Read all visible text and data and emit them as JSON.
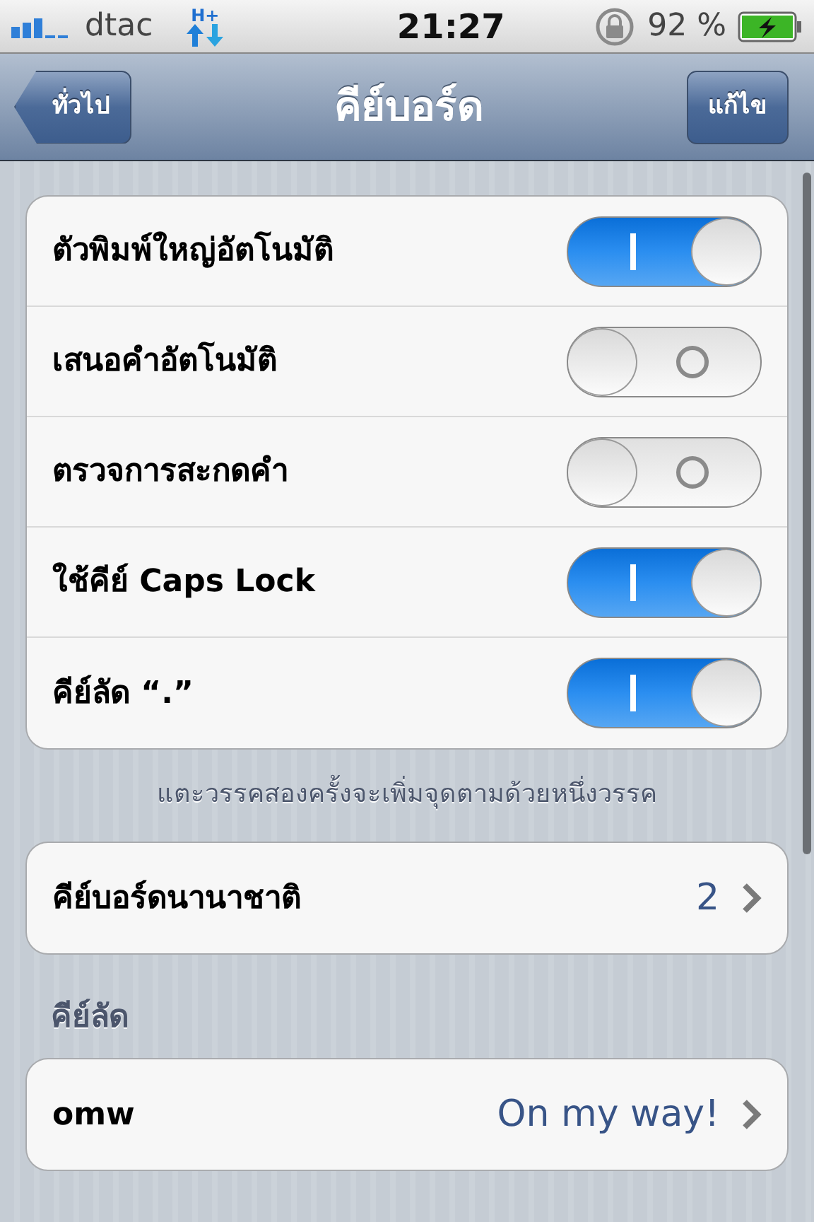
{
  "status_bar": {
    "carrier": "dtac",
    "network": "H+",
    "time": "21:27",
    "battery_text": "92 %"
  },
  "nav_bar": {
    "back_button": "ทั่วไป",
    "title": "คีย์บอร์ด",
    "edit_button": "แก้ไข"
  },
  "toggles": [
    {
      "label": "ตัวพิมพ์ใหญ่อัตโนมัติ",
      "on": true
    },
    {
      "label": "เสนอคำอัตโนมัติ",
      "on": false
    },
    {
      "label": "ตรวจการสะกดคำ",
      "on": false
    },
    {
      "label": "ใช้คีย์ Caps Lock",
      "on": true
    },
    {
      "label": "คีย์ลัด “.”",
      "on": true
    }
  ],
  "toggles_footer": "แตะวรรคสองครั้งจะเพิ่มจุดตามด้วยหนึ่งวรรค",
  "international": {
    "label": "คีย์บอร์ดนานาชาติ",
    "value": "2"
  },
  "shortcuts": {
    "header": "คีย์ลัด",
    "items": [
      {
        "label": "omw",
        "value": "On my way!"
      }
    ]
  }
}
